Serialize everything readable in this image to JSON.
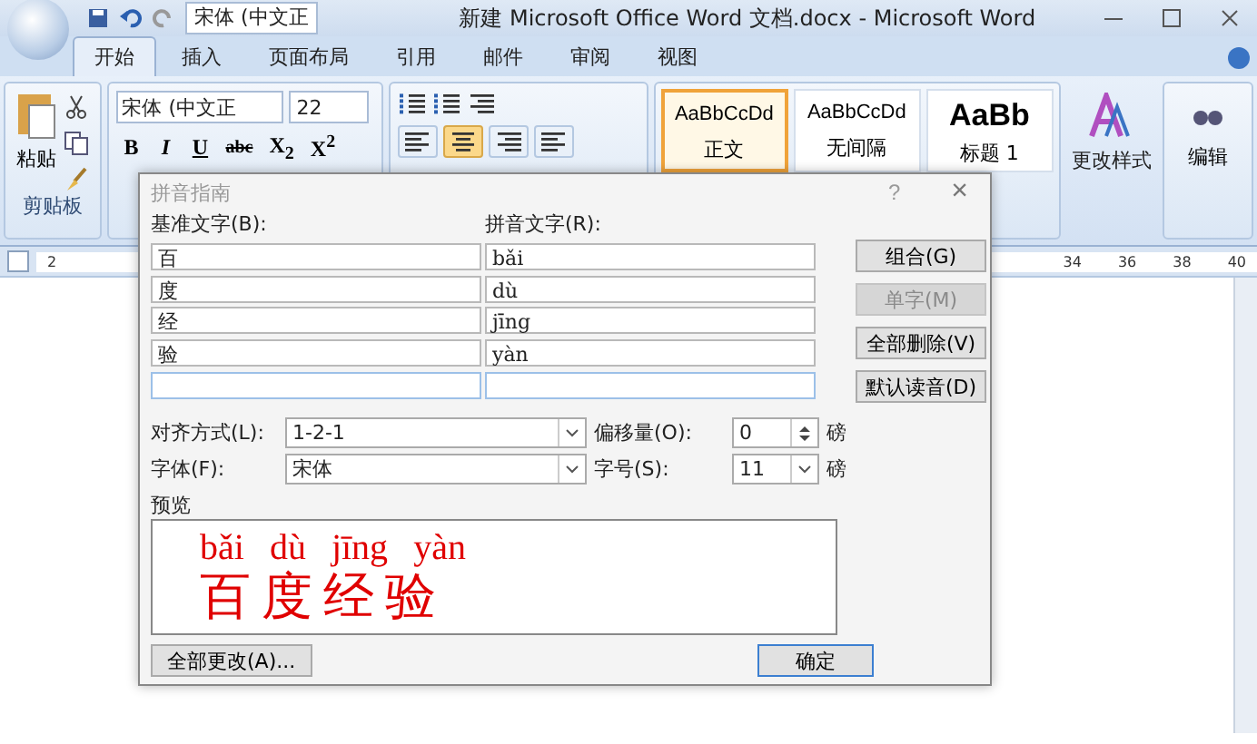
{
  "window": {
    "title": "新建 Microsoft Office Word 文档.docx - Microsoft Word",
    "quick_font": "宋体 (中文正"
  },
  "tabs": [
    {
      "label": "开始",
      "selected": true
    },
    {
      "label": "插入",
      "selected": false
    },
    {
      "label": "页面布局",
      "selected": false
    },
    {
      "label": "引用",
      "selected": false
    },
    {
      "label": "邮件",
      "selected": false
    },
    {
      "label": "审阅",
      "selected": false
    },
    {
      "label": "视图",
      "selected": false
    }
  ],
  "ribbon": {
    "paste": "粘贴",
    "clipboard_label": "剪贴板",
    "font_name": "宋体 (中文正",
    "font_size": "22",
    "format_buttons": [
      "B",
      "I",
      "U",
      "abc",
      "X$_{2}$",
      "X$^{2}$"
    ],
    "styles": [
      {
        "sample": "AaBbCcDd",
        "name": "正文",
        "selected": true
      },
      {
        "sample": "AaBbCcDd",
        "name": "无间隔",
        "selected": false
      },
      {
        "sample": "AaBb",
        "name": "标题 1",
        "selected": false
      }
    ],
    "change_styles": "更改样式",
    "editing": "编辑"
  },
  "ruler": {
    "left_marks": [
      "2"
    ],
    "right_marks": [
      "34",
      "36",
      "38",
      "40"
    ]
  },
  "dialog": {
    "title": "拼音指南",
    "help": "?",
    "close": "×",
    "base_label": "基准文字(B):",
    "ruby_label": "拼音文字(R):",
    "rows": [
      {
        "base": "百",
        "ruby": "bǎi"
      },
      {
        "base": "度",
        "ruby": "dù"
      },
      {
        "base": "经",
        "ruby": "jīng"
      },
      {
        "base": "验",
        "ruby": "yàn"
      }
    ],
    "side_buttons": [
      {
        "label": "组合(G)",
        "disabled": false
      },
      {
        "label": "单字(M)",
        "disabled": true
      },
      {
        "label": "全部删除(V)",
        "disabled": false
      },
      {
        "label": "默认读音(D)",
        "disabled": false
      }
    ],
    "alignment": {
      "label": "对齐方式(L):",
      "value": "1-2-1"
    },
    "offset": {
      "label": "偏移量(O):",
      "value": "0",
      "unit": "磅"
    },
    "font": {
      "label": "字体(F):",
      "value": "宋体"
    },
    "size": {
      "label": "字号(S):",
      "value": "11",
      "unit": "磅"
    },
    "preview": {
      "label": "预览",
      "pinyin": [
        "bǎi",
        "dù",
        "jīng",
        "yàn"
      ],
      "text": "百度经验"
    },
    "change_all": "全部更改(A)...",
    "ok": "确定"
  }
}
